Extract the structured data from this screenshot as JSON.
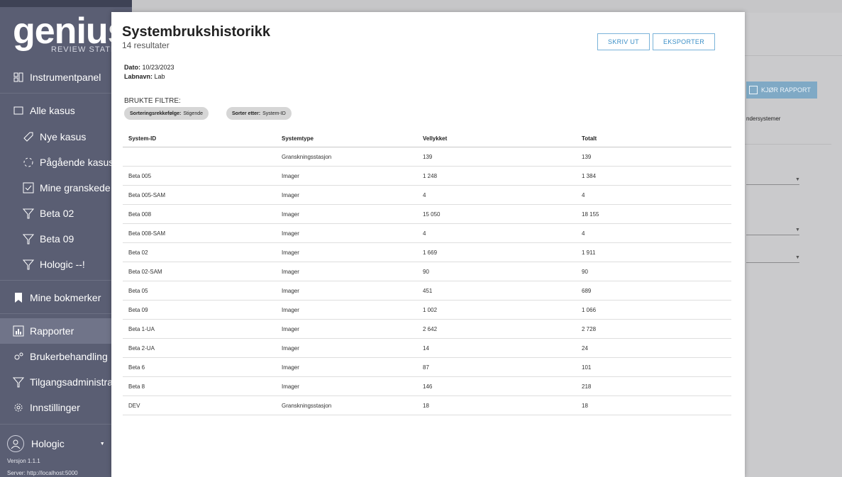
{
  "sidebar": {
    "logo": "genius",
    "tagline": "REVIEW STATIO",
    "items": [
      {
        "label": "Instrumentpanel",
        "icon": "dashboard-icon"
      },
      {
        "label": "Alle kasus",
        "icon": "folder-icon"
      },
      {
        "label": "Nye kasus",
        "icon": "tag-icon"
      },
      {
        "label": "Pågående kasus",
        "icon": "progress-icon"
      },
      {
        "label": "Mine granskede ka",
        "icon": "checkbox-icon"
      },
      {
        "label": "Beta 02",
        "icon": "filter-icon"
      },
      {
        "label": "Beta 09",
        "icon": "filter-icon"
      },
      {
        "label": "Hologic --!",
        "icon": "filter-icon"
      },
      {
        "label": "Mine bokmerker",
        "icon": "bookmark-icon"
      },
      {
        "label": "Rapporter",
        "icon": "chart-icon"
      },
      {
        "label": "Brukerbehandling",
        "icon": "users-icon"
      },
      {
        "label": "Tilgangsadministrasjo",
        "icon": "lock-icon"
      },
      {
        "label": "Innstillinger",
        "icon": "gear-icon"
      }
    ],
    "user": "Hologic",
    "version": "Versjon 1.1.1",
    "server": "Server: http://localhost:5000"
  },
  "background": {
    "run_report_label": "KJØR RAPPORT",
    "subsystems_text": "ndersystemer"
  },
  "modal": {
    "title": "Systembrukshistorikk",
    "subtitle": "14 resultater",
    "print_label": "SKRIV UT",
    "export_label": "EKSPORTER",
    "date_label": "Dato:",
    "date_value": "10/23/2023",
    "lab_label": "Labnavn:",
    "lab_value": "Lab",
    "filters_title": "BRUKTE FILTRE:",
    "filters": [
      {
        "key": "Sorteringsrekkefølge:",
        "value": "Stigende"
      },
      {
        "key": "Sorter etter:",
        "value": "System-ID"
      }
    ],
    "columns": [
      "System-ID",
      "Systemtype",
      "Vellykket",
      "Totalt"
    ],
    "rows": [
      [
        "",
        "Granskningsstasjon",
        "139",
        "139"
      ],
      [
        "Beta 005",
        "Imager",
        "1 248",
        "1 384"
      ],
      [
        "Beta 005-SAM",
        "Imager",
        "4",
        "4"
      ],
      [
        "Beta 008",
        "Imager",
        "15 050",
        "18 155"
      ],
      [
        "Beta 008-SAM",
        "Imager",
        "4",
        "4"
      ],
      [
        "Beta 02",
        "Imager",
        "1 669",
        "1 911"
      ],
      [
        "Beta 02-SAM",
        "Imager",
        "90",
        "90"
      ],
      [
        "Beta 05",
        "Imager",
        "451",
        "689"
      ],
      [
        "Beta 09",
        "Imager",
        "1 002",
        "1 066"
      ],
      [
        "Beta 1-UA",
        "Imager",
        "2 642",
        "2 728"
      ],
      [
        "Beta 2-UA",
        "Imager",
        "14",
        "24"
      ],
      [
        "Beta 6",
        "Imager",
        "87",
        "101"
      ],
      [
        "Beta 8",
        "Imager",
        "146",
        "218"
      ],
      [
        "DEV",
        "Granskningsstasjon",
        "18",
        "18"
      ]
    ]
  }
}
